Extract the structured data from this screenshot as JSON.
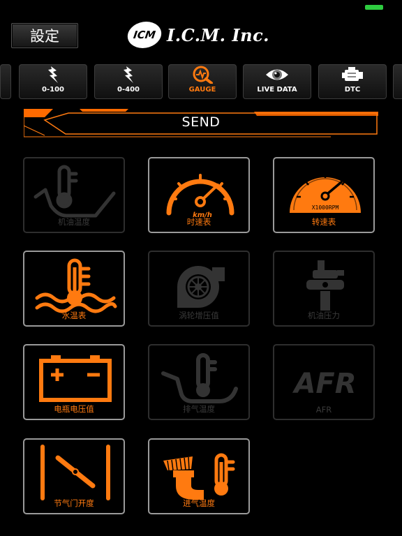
{
  "status_bar": {
    "battery_color": "#2ecc40"
  },
  "header": {
    "settings_label": "設定",
    "logo_badge": "ICM",
    "logo_text": "I.C.M. Inc."
  },
  "tabs": [
    {
      "label": "0-100",
      "icon": "lightning-icon"
    },
    {
      "label": "0-400",
      "icon": "lightning-icon"
    },
    {
      "label": "GAUGE",
      "icon": "gauge-magnifier-icon",
      "active": true
    },
    {
      "label": "LIVE DATA",
      "icon": "eye-icon"
    },
    {
      "label": "DTC",
      "icon": "engine-icon"
    }
  ],
  "send_label": "SEND",
  "gauges": [
    {
      "label": "机油温度",
      "icon": "oil-temperature-icon",
      "enabled": false
    },
    {
      "label": "时速表",
      "icon": "speedometer-icon",
      "enabled": true,
      "unit": "km/h"
    },
    {
      "label": "转速表",
      "icon": "tachometer-icon",
      "enabled": true,
      "unit": "X1000RPM"
    },
    {
      "label": "水温表",
      "icon": "coolant-temperature-icon",
      "enabled": true
    },
    {
      "label": "涡轮增压值",
      "icon": "turbo-icon",
      "enabled": false
    },
    {
      "label": "机油压力",
      "icon": "oil-pressure-icon",
      "enabled": false
    },
    {
      "label": "电瓶电压值",
      "icon": "battery-icon",
      "enabled": true
    },
    {
      "label": "排气温度",
      "icon": "exhaust-temperature-icon",
      "enabled": false
    },
    {
      "label": "AFR",
      "icon": "afr-icon",
      "enabled": false,
      "icon_text": "AFR"
    },
    {
      "label": "节气门开度",
      "icon": "throttle-icon",
      "enabled": true
    },
    {
      "label": "进气温度",
      "icon": "intake-temperature-icon",
      "enabled": true
    }
  ],
  "colors": {
    "accent": "#ff7a10",
    "disabled": "#333333"
  }
}
